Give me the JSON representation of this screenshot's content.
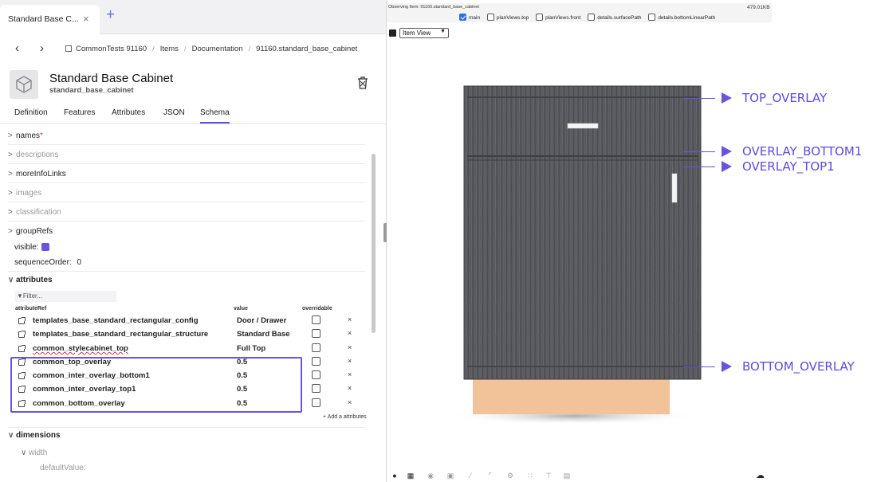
{
  "browser": {
    "tab_title": "Standard Base C...",
    "close_glyph": "×",
    "new_tab_glyph": "+"
  },
  "nav": {
    "back_glyph": "‹",
    "forward_glyph": "›",
    "breadcrumbs": [
      "CommonTests 91160",
      "Items",
      "Documentation",
      "91160.standard_base_cabinet"
    ],
    "separator": "/"
  },
  "item": {
    "title": "Standard Base Cabinet",
    "id": "standard_base_cabinet"
  },
  "tabs": [
    "Definition",
    "Features",
    "Attributes",
    "JSON",
    "Schema"
  ],
  "active_tab": "Schema",
  "tree": {
    "names": "names",
    "names_required_mark": "*",
    "descriptions": "descriptions",
    "moreInfoLinks": "moreInfoLinks",
    "images": "images",
    "classification": "classification",
    "groupRefs": "groupRefs",
    "visible_label": "visible:",
    "sequenceOrder_label": "sequenceOrder:",
    "sequenceOrder_value": "0",
    "attributes": "attributes",
    "dimensions": "dimensions",
    "width": "width",
    "defaultValue": "defaultValue:",
    "chev_right": ">",
    "chev_down": "∨"
  },
  "attr_table": {
    "filter_placeholder": "Filter...",
    "col_attributeRef": "attributeRef",
    "col_value": "value",
    "col_overridable": "overridable",
    "add_label": "+ Add a attributes",
    "delete_glyph": "×",
    "rows": [
      {
        "name": "templates_base_standard_rectangular_config",
        "value": "Door / Drawer"
      },
      {
        "name": "templates_base_standard_rectangular_structure",
        "value": "Standard Base"
      },
      {
        "name": "common_stylecabinet_top",
        "value": "Full Top"
      },
      {
        "name": "common_top_overlay",
        "value": "0.5"
      },
      {
        "name": "common_inter_overlay_bottom1",
        "value": "0.5"
      },
      {
        "name": "common_inter_overlay_top1",
        "value": "0.5"
      },
      {
        "name": "common_bottom_overlay",
        "value": "0.5"
      }
    ]
  },
  "viewer": {
    "observing": "Observing Item: 91160.standard_base_cabinet",
    "size": "479.01KB",
    "views": [
      "main",
      "planViews.top",
      "planViews.front",
      "details.surfacePath",
      "details.bottomLinearPath"
    ],
    "checked_view": "main",
    "view_mode": "Item View",
    "annotations": [
      "TOP_OVERLAY",
      "OVERLAY_BOTTOM1",
      "OVERLAY_TOP1",
      "BOTTOM_OVERLAY"
    ]
  },
  "colors": {
    "accent": "#6b53e0",
    "annotation": "#5b4be0",
    "cabinet": "#55565b",
    "toekick": "#f2c298",
    "checkbox_on": "#2d6ee0"
  },
  "icons": {
    "toolbar": [
      "palette-icon",
      "grid-icon",
      "compass-icon",
      "cube-icon",
      "brush-icon",
      "crop-icon",
      "settings-icon",
      "dots-grid-icon",
      "hierarchy-icon",
      "gallery-icon"
    ],
    "cloud": "cloud-download-icon"
  }
}
